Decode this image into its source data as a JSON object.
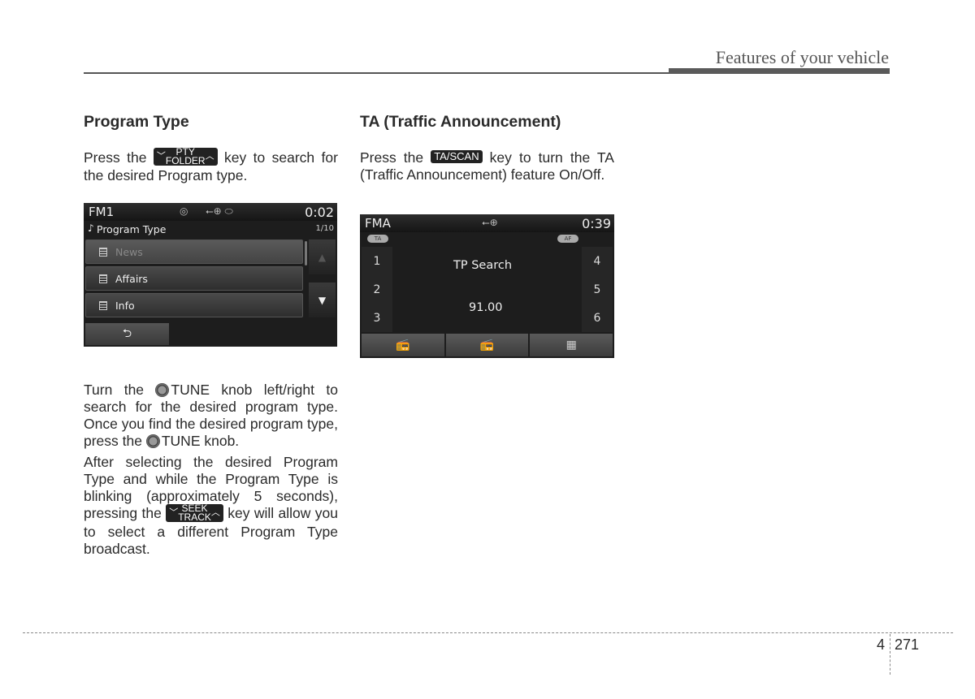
{
  "header": {
    "section_title": "Features of your vehicle"
  },
  "col1": {
    "heading": "Program Type",
    "p1_pre": "Press the",
    "p1_key_top": "PTY",
    "p1_key_bottom": "FOLDER",
    "p1_post": "key to search for the desired Program type.",
    "screen": {
      "mode": "FM1",
      "time": "0:02",
      "title": "Program Type",
      "page": "1/10",
      "items": [
        "News",
        "Affairs",
        "Info"
      ],
      "up_icon": "▲",
      "down_icon": "▼",
      "back_icon": "⮌"
    },
    "p2_a": "Turn the",
    "p2_b": "TUNE knob left/right to search for the desired program type. Once you find the desired program type, press the",
    "p2_c": "TUNE knob.",
    "p3_pre": "After selecting the desired Program Type and while the Program Type is blinking (approximately 5 seconds), pressing the",
    "p3_key_top": "SEEK",
    "p3_key_bottom": "TRACK",
    "p3_post": "key will allow you to select a different Program Type broadcast."
  },
  "col2": {
    "heading": "TA (Traffic Announcement)",
    "p1_pre": "Press the",
    "p1_key": "TA/SCAN",
    "p1_post": "key to turn the TA (Traffic Announcement) feature On/Off.",
    "screen": {
      "mode": "FMA",
      "time": "0:39",
      "ta_label": "TA",
      "af_label": "AF",
      "presets_left": [
        "1",
        "2",
        "3"
      ],
      "presets_right": [
        "4",
        "5",
        "6"
      ],
      "status": "TP Search",
      "frequency": "91.00"
    }
  },
  "footer": {
    "chapter": "4",
    "page": "271"
  }
}
